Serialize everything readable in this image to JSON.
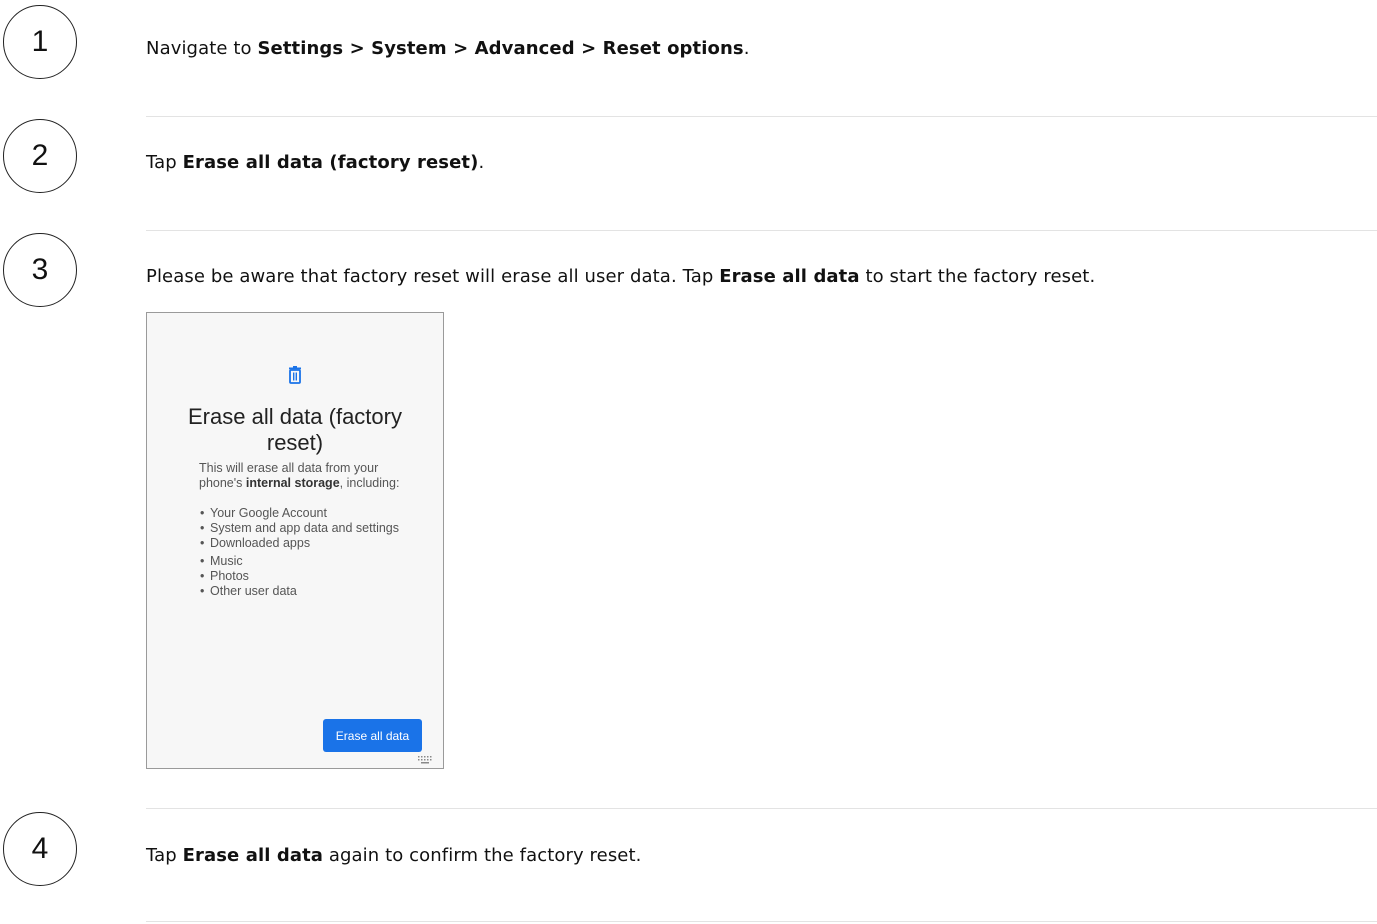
{
  "steps": [
    {
      "number": "1",
      "parts": [
        {
          "text": "Navigate to ",
          "bold": false
        },
        {
          "text": "Settings > System > Advanced > Reset options",
          "bold": true
        },
        {
          "text": ".",
          "bold": false
        }
      ]
    },
    {
      "number": "2",
      "parts": [
        {
          "text": "Tap ",
          "bold": false
        },
        {
          "text": "Erase all data (factory reset)",
          "bold": true
        },
        {
          "text": ".",
          "bold": false
        }
      ]
    },
    {
      "number": "3",
      "parts": [
        {
          "text": "Please be aware that factory reset will erase all user data. Tap ",
          "bold": false
        },
        {
          "text": "Erase all data",
          "bold": true
        },
        {
          "text": " to start the factory reset.",
          "bold": false
        }
      ]
    },
    {
      "number": "4",
      "parts": [
        {
          "text": "Tap ",
          "bold": false
        },
        {
          "text": "Erase all data",
          "bold": true
        },
        {
          "text": " again to confirm the factory reset.",
          "bold": false
        }
      ]
    }
  ],
  "phone": {
    "icon": "trash-icon",
    "title_line1": "Erase all data (factory",
    "title_line2": "reset)",
    "desc_line1": "This will erase all data from your",
    "desc_prefix": "phone's ",
    "desc_bold": "internal storage",
    "desc_suffix": ", including:",
    "items": [
      "Your Google Account",
      "System and app data and settings",
      "Downloaded apps",
      "Music",
      "Photos",
      "Other user data"
    ],
    "button_label": "Erase all data",
    "accent_color": "#1a73e8"
  }
}
